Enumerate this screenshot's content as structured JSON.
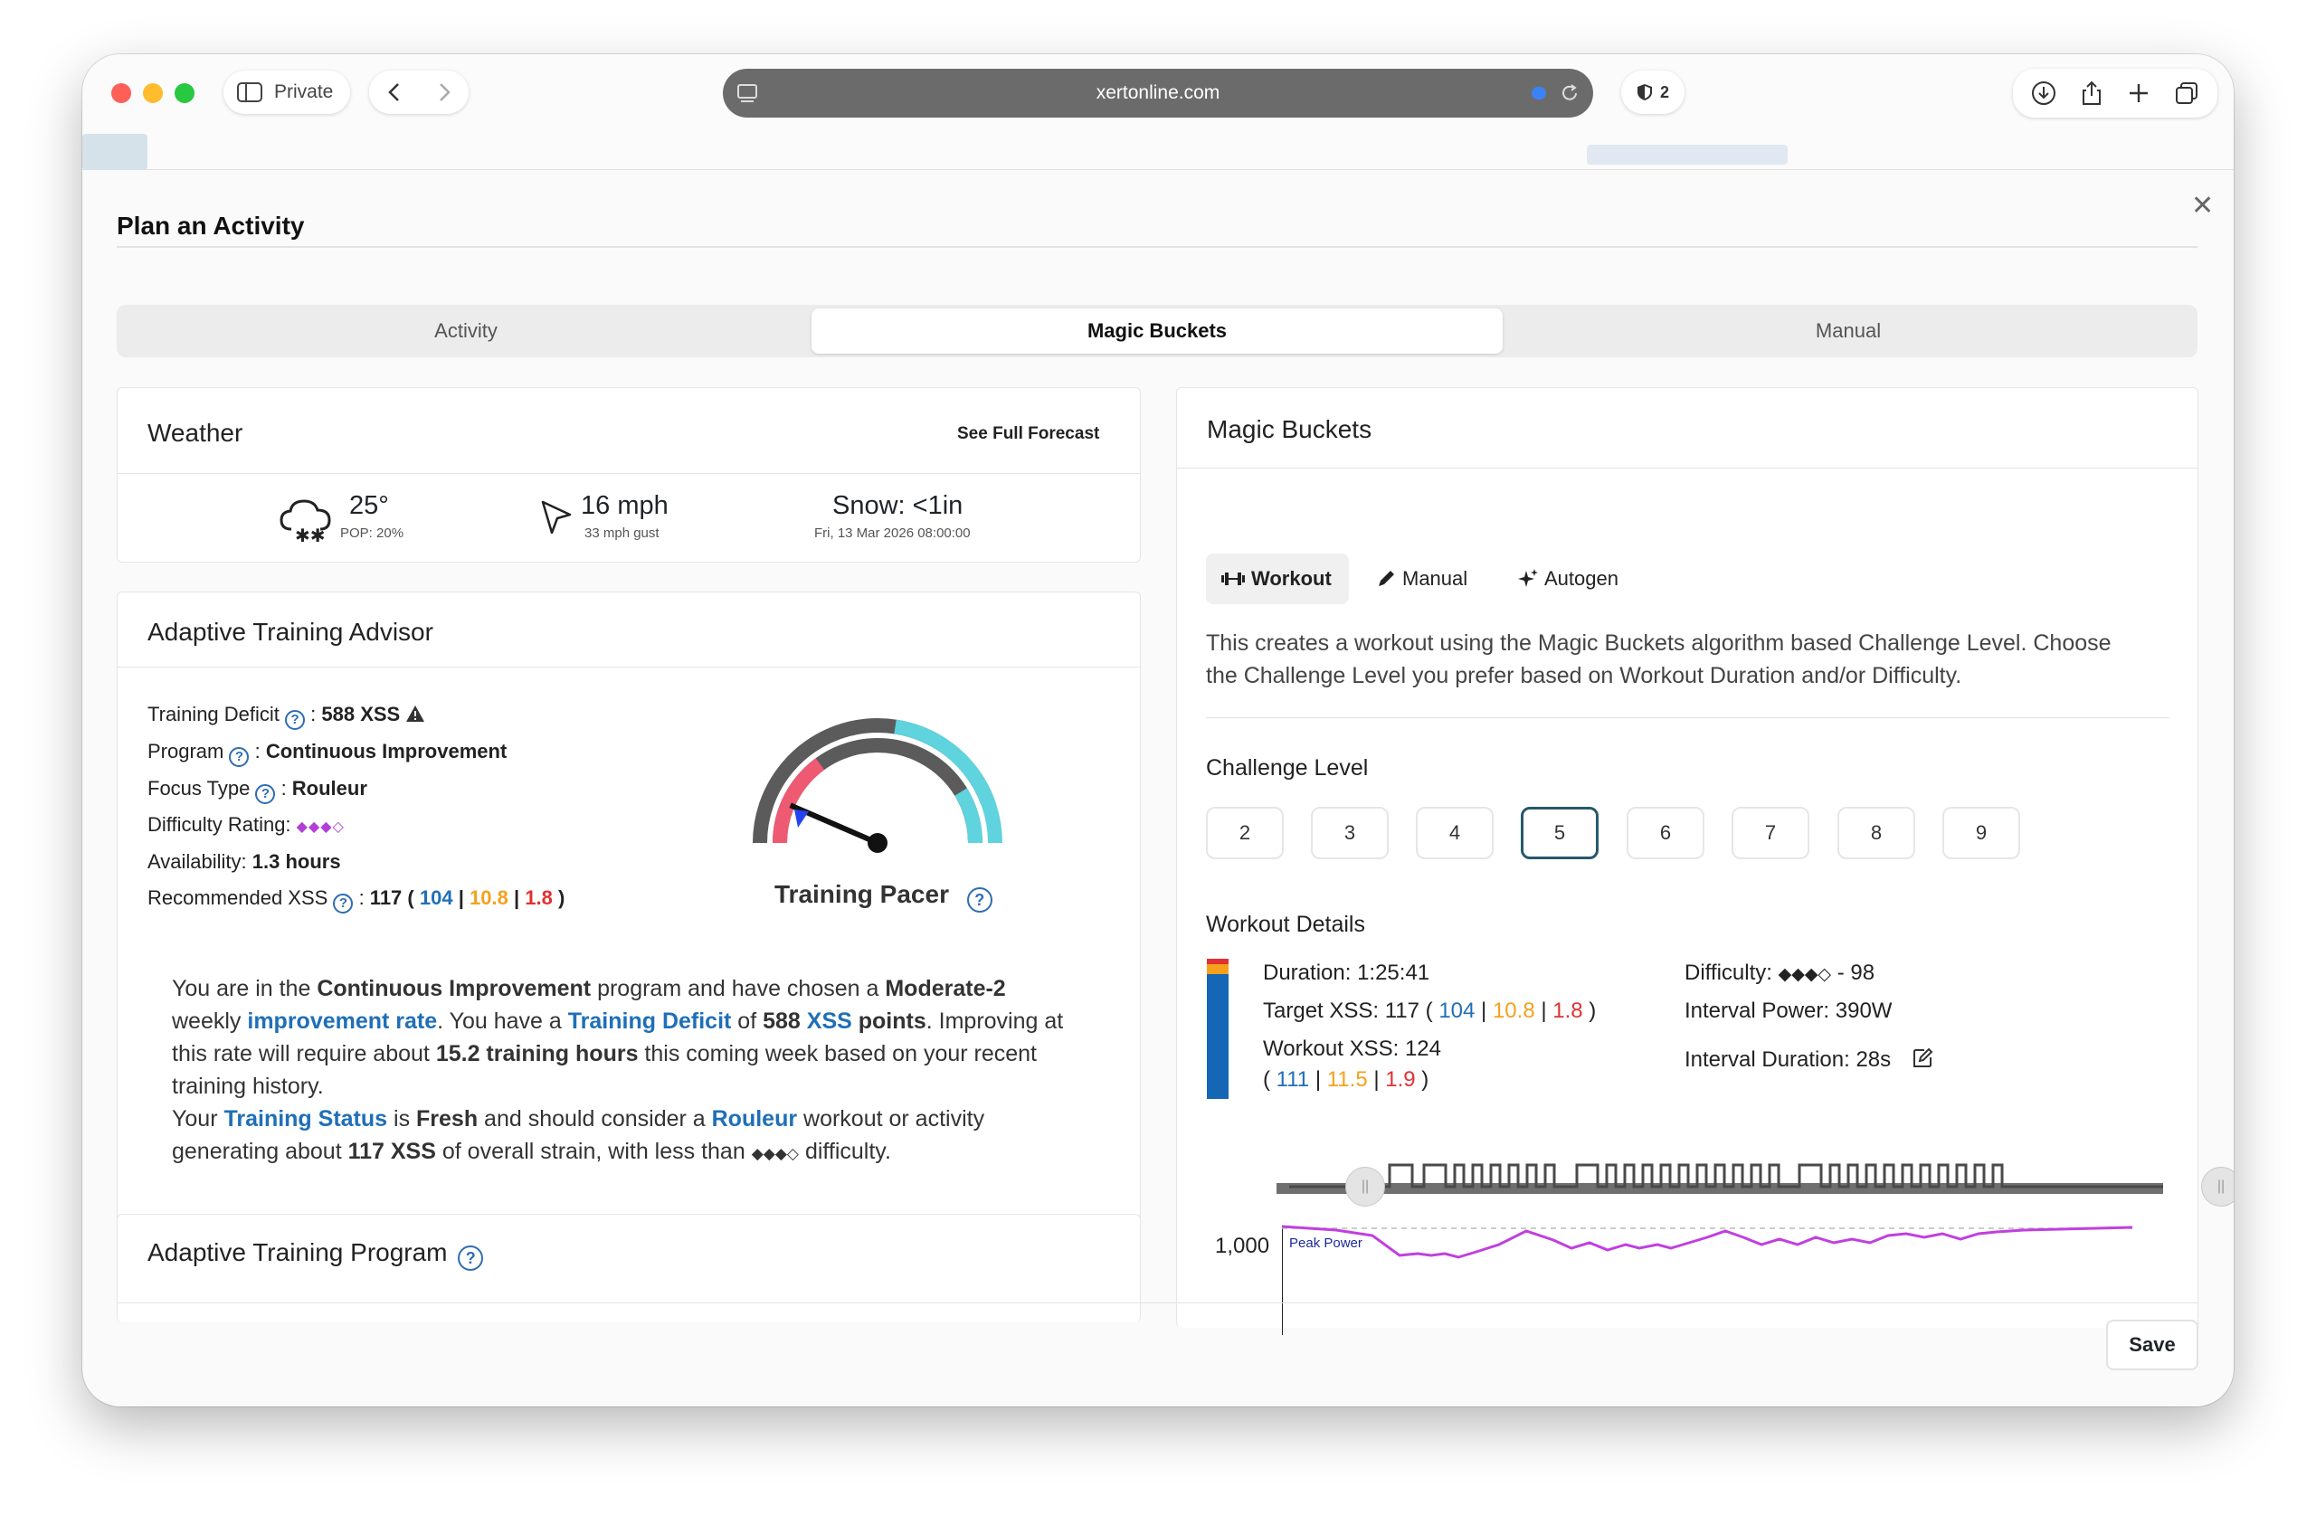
{
  "browser": {
    "private_label": "Private",
    "url": "xertonline.com",
    "shield_count": "2"
  },
  "modal": {
    "title": "Plan an Activity",
    "tabs": [
      "Activity",
      "Magic Buckets",
      "Manual"
    ],
    "save_label": "Save"
  },
  "weather": {
    "title": "Weather",
    "forecast_link": "See Full Forecast",
    "temp": "25°",
    "pop": "POP: 20%",
    "wind": "16 mph",
    "gust": "33 mph gust",
    "precip": "Snow: <1in",
    "datetime": "Fri, 13 Mar 2026 08:00:00"
  },
  "advisor": {
    "title": "Adaptive Training Advisor",
    "deficit_label": "Training Deficit",
    "deficit_value": "588 XSS",
    "program_label": "Program",
    "program_value": "Continuous Improvement",
    "focus_label": "Focus Type",
    "focus_value": "Rouleur",
    "difficulty_label": "Difficulty Rating:",
    "difficulty_value": "◆◆◆◇",
    "availability_label": "Availability:",
    "availability_value": "1.3 hours",
    "rec_label": "Recommended XSS",
    "rec_total": "117",
    "rec_low": "104",
    "rec_high": "10.8",
    "rec_peak": "1.8",
    "pacer_label": "Training Pacer",
    "pacer_fraction": 0.13,
    "p1": {
      "a": "You are in the ",
      "b": "Continuous Improvement",
      "c": " program and have chosen a ",
      "d": "Moderate-2",
      "e": "weekly ",
      "f": "improvement rate",
      "g": ". You have a ",
      "h": "Training Deficit",
      "i": " of ",
      "j": "588",
      "k": "XSS",
      "l": "points",
      "m": ". Improving at",
      "n": "this rate will require about ",
      "o": "15.2 training hours",
      "p": " this coming week based on your recent",
      "q": "training history."
    },
    "p2": {
      "a": "Your ",
      "b": "Training Status",
      "c": " is ",
      "d": "Fresh",
      "e": " and should consider a ",
      "f": "Rouleur",
      "g": " workout or activity",
      "h": "generating about ",
      "i": "117 XSS",
      "j": " of overall strain, with less than ",
      "k": "◆◆◆◇",
      "l": " difficulty."
    }
  },
  "program": {
    "title": "Adaptive Training Program"
  },
  "magic": {
    "title": "Magic Buckets",
    "subtabs": [
      "Workout",
      "Manual",
      "Autogen"
    ],
    "desc1": "This creates a workout using the Magic Buckets algorithm based Challenge Level. Choose",
    "desc2": "the Challenge Level you prefer based on Workout Duration and/or Difficulty.",
    "challenge_title": "Challenge Level",
    "levels": [
      "2",
      "3",
      "4",
      "5",
      "6",
      "7",
      "8",
      "9"
    ],
    "selected_level": "5",
    "details_title": "Workout Details",
    "duration_label": "Duration:",
    "duration": "1:25:41",
    "target_label": "Target XSS:",
    "target_total": "117",
    "target_low": "104",
    "target_high": "10.8",
    "target_peak": "1.8",
    "workout_label": "Workout XSS:",
    "workout_total": "124",
    "workout_low": "111",
    "workout_high": "11.5",
    "workout_peak": "1.9",
    "difficulty_label": "Difficulty:",
    "difficulty_stars": "◆◆◆◇",
    "difficulty_value": "- 98",
    "interval_power_label": "Interval Power:",
    "interval_power": "390W",
    "interval_duration_label": "Interval Duration:",
    "interval_duration": "28s",
    "chart_ytick": "1,000",
    "chart_series": "Peak Power"
  },
  "colors": {
    "accent_blue": "#1f6fb8",
    "orange": "#f5a11e",
    "red": "#e03131",
    "gauge_teal": "#5fd3de",
    "gauge_pink": "#ee5a72",
    "peak_power": "#c13fe0"
  }
}
